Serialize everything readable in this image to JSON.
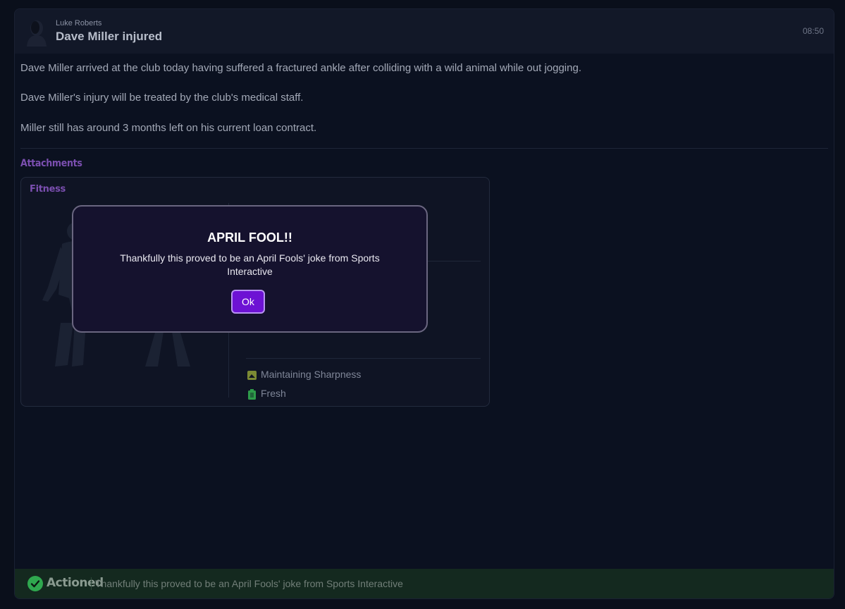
{
  "message": {
    "sender": "Luke Roberts",
    "subject": "Dave Miller injured",
    "time": "08:50",
    "paragraphs": [
      "Dave Miller arrived at the club today having suffered a fractured ankle after colliding with a wild animal while out jogging.",
      "Dave Miller's injury will be treated by the club's medical staff.",
      "Miller still has around 3 months left on his current loan contract."
    ]
  },
  "attachments": {
    "title": "Attachments",
    "fitness": {
      "title": "Fitness",
      "statuses": [
        {
          "label": "Maintaining Sharpness",
          "icon": "sharpness-icon",
          "color": "#8a9a3a"
        },
        {
          "label": "Fresh",
          "icon": "battery-icon",
          "color": "#2e9a4a"
        }
      ]
    }
  },
  "modal": {
    "title": "APRIL FOOL!!",
    "message": "Thankfully this proved to be an April Fools' joke from Sports Interactive",
    "ok_label": "Ok"
  },
  "footer": {
    "status": "Actioned",
    "message": "Thankfully this proved to be an April Fools' joke from Sports Interactive"
  },
  "colors": {
    "accent_purple": "#7b4fb0",
    "button_purple": "#6d12d4",
    "success_green": "#2fa84f"
  }
}
